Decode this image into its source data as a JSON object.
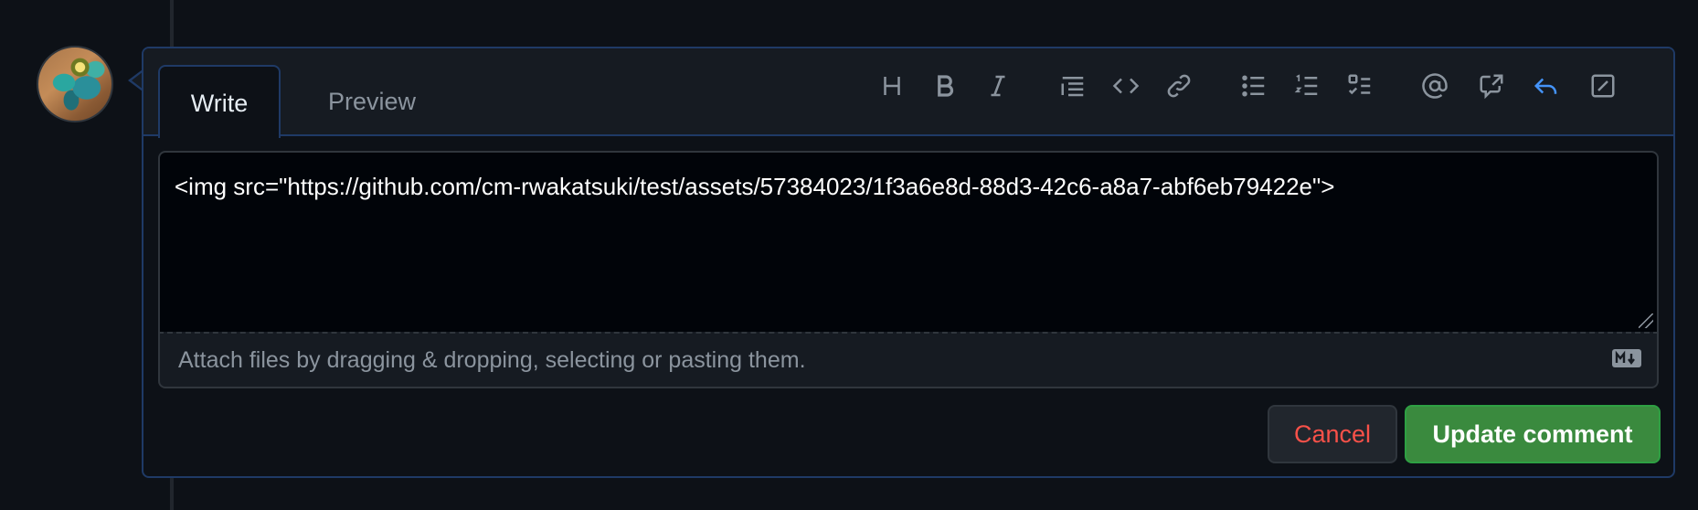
{
  "editor": {
    "tabs": {
      "write": "Write",
      "preview": "Preview"
    },
    "toolbar": [
      {
        "icon": "heading-icon",
        "label": "Heading"
      },
      {
        "icon": "bold-icon",
        "label": "Bold"
      },
      {
        "icon": "italic-icon",
        "label": "Italic"
      },
      {
        "icon": "quote-icon",
        "label": "Quote"
      },
      {
        "icon": "code-icon",
        "label": "Code"
      },
      {
        "icon": "link-icon",
        "label": "Link"
      },
      {
        "icon": "unordered-list-icon",
        "label": "Unordered list"
      },
      {
        "icon": "ordered-list-icon",
        "label": "Ordered list"
      },
      {
        "icon": "task-list-icon",
        "label": "Task list"
      },
      {
        "icon": "mention-icon",
        "label": "Mention"
      },
      {
        "icon": "cross-reference-icon",
        "label": "Reference"
      },
      {
        "icon": "reply-icon",
        "label": "Saved replies"
      },
      {
        "icon": "fullscreen-icon",
        "label": "Fullscreen"
      }
    ],
    "body_text": "<img src=\"https://github.com/cm-rwakatsuki/test/assets/57384023/1f3a6e8d-88d3-42c6-a8a7-abf6eb79422e\">",
    "attach_hint": "Attach files by dragging & dropping, selecting or pasting them.",
    "markdown_icon": "markdown-icon"
  },
  "actions": {
    "cancel_label": "Cancel",
    "submit_label": "Update comment"
  },
  "colors": {
    "background": "#0d1117",
    "accent_border": "#1f3a66",
    "cancel_text": "#f85149",
    "submit_bg": "#3a8a3e",
    "active_icon": "#4493f8"
  }
}
